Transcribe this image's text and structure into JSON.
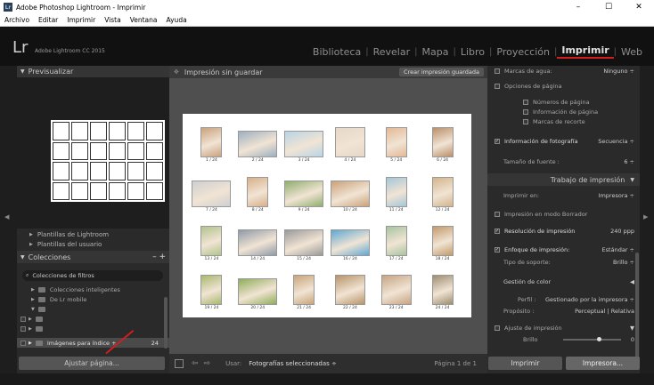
{
  "window": {
    "title": "Adobe Photoshop Lightroom - Imprimir",
    "icon_label": "Lr",
    "controls": [
      "–",
      "☐",
      "✕"
    ]
  },
  "menu": [
    "Archivo",
    "Editar",
    "Imprimir",
    "Vista",
    "Ventana",
    "Ayuda"
  ],
  "identity": {
    "logo": "Lr",
    "version": "Adobe Lightroom CC 2015"
  },
  "modules": [
    "Biblioteca",
    "Revelar",
    "Mapa",
    "Libro",
    "Proyección",
    "Imprimir",
    "Web"
  ],
  "active_module": "Imprimir",
  "left": {
    "preview_title": "Previsualizar",
    "templates": [
      "Plantillas de Lightroom",
      "Plantillas del usuario"
    ],
    "collections_title": "Colecciones",
    "collections_controls": "– +",
    "search_label": "Colecciones de filtros",
    "collection_items": [
      {
        "label": "Colecciones inteligentes",
        "count": ""
      },
      {
        "label": "De Lr mobile",
        "count": ""
      },
      {
        "label": "",
        "count": ""
      },
      {
        "label": "",
        "count": ""
      },
      {
        "label": "",
        "count": ""
      },
      {
        "label": "Imágenes para índice +",
        "count": "24"
      }
    ],
    "page_setup_button": "Ajustar página..."
  },
  "center": {
    "title": "Impresión sin guardar",
    "save_button": "Crear impresión guardada",
    "captions": [
      "1 / 24",
      "2 / 24",
      "3 / 24",
      "4 / 24",
      "5 / 24",
      "6 / 24",
      "7 / 24",
      "8 / 24",
      "9 / 24",
      "10 / 24",
      "11 / 24",
      "12 / 24",
      "13 / 24",
      "14 / 24",
      "15 / 24",
      "16 / 24",
      "17 / 24",
      "18 / 24",
      "19 / 24",
      "20 / 24",
      "21 / 24",
      "22 / 24",
      "23 / 24",
      "24 / 24"
    ],
    "toolbar": {
      "use_label": "Usar:",
      "use_value": "Fotografías seleccionadas ÷",
      "page": "Página 1 de 1"
    }
  },
  "right": {
    "rows": {
      "watermark": "Marcas de agua:",
      "watermark_value": "Ninguno ÷",
      "page_options": "Opciones de página",
      "page_numbers": "Números de página",
      "page_info": "Información de página",
      "crop_marks": "Marcas de recorte",
      "photo_info": "Información de fotografía",
      "photo_info_value": "Secuencia ÷",
      "font_size": "Tamaño de fuente :",
      "font_size_value": "6 ÷",
      "print_job": "Trabajo de impresión",
      "print_to": "Imprimir en:",
      "print_to_value": "Impresora ÷",
      "draft": "Impresión en modo Borrador",
      "resolution": "Resolución de impresión",
      "resolution_value": "240 ppp",
      "sharpen": "Enfoque de impresión:",
      "sharpen_value": "Estándar ÷",
      "media": "Tipo de soporte:",
      "media_value": "Brillo ÷",
      "color_mgmt": "Gestión de color",
      "profile": "Perfil :",
      "profile_value": "Gestionado por la impresora ÷",
      "intent": "Propósito :",
      "intent_value": "Perceptual | Relativa",
      "adjust": "Ajuste de impresión",
      "brightness": "Brillo",
      "brightness_value": "0"
    },
    "print_button": "Imprimir",
    "printer_button": "Impresora..."
  },
  "colors": {
    "accent": "#d21e1e",
    "panel": "#2a2a2a",
    "center": "#4f4f4f"
  }
}
